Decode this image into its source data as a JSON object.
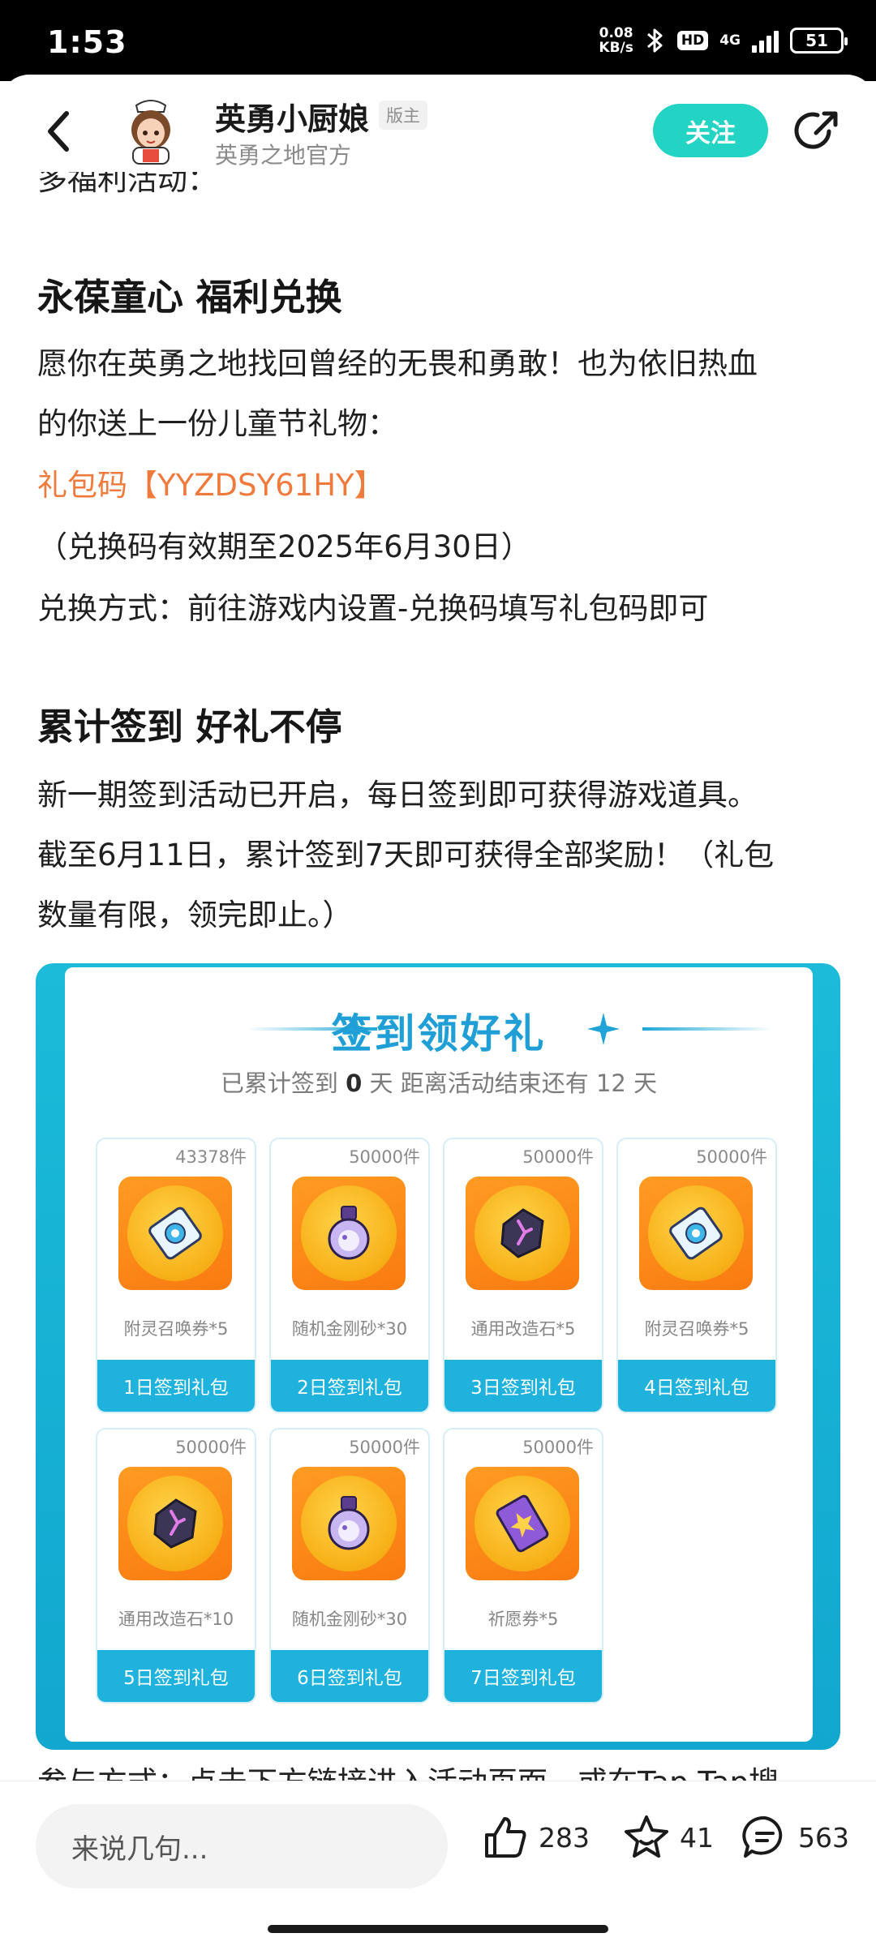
{
  "status_bar": {
    "time": "1:53",
    "net_speed_value": "0.08",
    "net_speed_unit": "KB/s",
    "hd_label": "HD",
    "network_label": "4G",
    "battery": "51"
  },
  "header": {
    "author_name": "英勇小厨娘",
    "author_badge": "版主",
    "author_subtitle": "英勇之地官方",
    "follow_label": "关注"
  },
  "article": {
    "cut_top_text": "多福利活动：",
    "section1_title": "永葆童心 福利兑换",
    "section1_para1_line1": "愿你在英勇之地找回曾经的无畏和勇敢！也为依旧热血",
    "section1_para1_line2": "的你送上一份儿童节礼物：",
    "gift_code": "礼包码【YYZDSY61HY】",
    "code_validity": "（兑换码有效期至2025年6月30日）",
    "redeem_method": "兑换方式：前往游戏内设置-兑换码填写礼包码即可",
    "section2_title": "累计签到 好礼不停",
    "section2_line1": "新一期签到活动已开启，每日签到即可获得游戏道具。",
    "section2_line2": "截至6月11日，累计签到7天即可获得全部奖励！（礼包",
    "section2_line3": "数量有限，领完即止。）",
    "cut_bottom_text": "参与方式：点击下方链接进入活动页面，或在Tap Tap搜"
  },
  "signin_image": {
    "title": "签到领好礼",
    "subtitle_prefix": "已累计签到",
    "signed_days": "0",
    "subtitle_mid": "天 距离活动结束还有",
    "remaining_days": "12",
    "subtitle_suffix": "天",
    "rewards": [
      {
        "qty": "43378件",
        "name": "附灵召唤券*5",
        "button": "1日签到礼包",
        "icon": "summon-ticket-icon"
      },
      {
        "qty": "50000件",
        "name": "随机金刚砂*30",
        "button": "2日签到礼包",
        "icon": "potion-flask-icon"
      },
      {
        "qty": "50000件",
        "name": "通用改造石*5",
        "button": "3日签到礼包",
        "icon": "rune-stone-icon"
      },
      {
        "qty": "50000件",
        "name": "附灵召唤券*5",
        "button": "4日签到礼包",
        "icon": "summon-ticket-icon"
      },
      {
        "qty": "50000件",
        "name": "通用改造石*10",
        "button": "5日签到礼包",
        "icon": "rune-stone-icon"
      },
      {
        "qty": "50000件",
        "name": "随机金刚砂*30",
        "button": "6日签到礼包",
        "icon": "potion-flask-icon"
      },
      {
        "qty": "50000件",
        "name": "祈愿券*5",
        "button": "7日签到礼包",
        "icon": "wish-ticket-icon"
      }
    ]
  },
  "bottom_bar": {
    "comment_placeholder": "来说几句...",
    "likes": "283",
    "favorites": "41",
    "comments": "563"
  },
  "colors": {
    "accent_teal": "#23d3c4",
    "highlight_orange": "#f07a3c",
    "signin_blue": "#1eb2dd"
  }
}
